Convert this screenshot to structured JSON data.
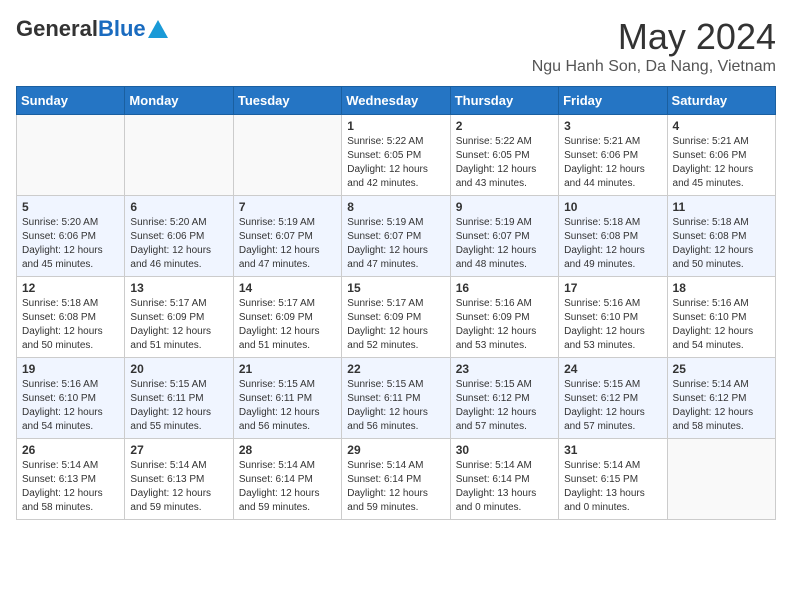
{
  "header": {
    "logo_general": "General",
    "logo_blue": "Blue",
    "title": "May 2024",
    "subtitle": "Ngu Hanh Son, Da Nang, Vietnam"
  },
  "days_of_week": [
    "Sunday",
    "Monday",
    "Tuesday",
    "Wednesday",
    "Thursday",
    "Friday",
    "Saturday"
  ],
  "weeks": [
    [
      {
        "day": "",
        "content": ""
      },
      {
        "day": "",
        "content": ""
      },
      {
        "day": "",
        "content": ""
      },
      {
        "day": "1",
        "content": "Sunrise: 5:22 AM\nSunset: 6:05 PM\nDaylight: 12 hours\nand 42 minutes."
      },
      {
        "day": "2",
        "content": "Sunrise: 5:22 AM\nSunset: 6:05 PM\nDaylight: 12 hours\nand 43 minutes."
      },
      {
        "day": "3",
        "content": "Sunrise: 5:21 AM\nSunset: 6:06 PM\nDaylight: 12 hours\nand 44 minutes."
      },
      {
        "day": "4",
        "content": "Sunrise: 5:21 AM\nSunset: 6:06 PM\nDaylight: 12 hours\nand 45 minutes."
      }
    ],
    [
      {
        "day": "5",
        "content": "Sunrise: 5:20 AM\nSunset: 6:06 PM\nDaylight: 12 hours\nand 45 minutes."
      },
      {
        "day": "6",
        "content": "Sunrise: 5:20 AM\nSunset: 6:06 PM\nDaylight: 12 hours\nand 46 minutes."
      },
      {
        "day": "7",
        "content": "Sunrise: 5:19 AM\nSunset: 6:07 PM\nDaylight: 12 hours\nand 47 minutes."
      },
      {
        "day": "8",
        "content": "Sunrise: 5:19 AM\nSunset: 6:07 PM\nDaylight: 12 hours\nand 47 minutes."
      },
      {
        "day": "9",
        "content": "Sunrise: 5:19 AM\nSunset: 6:07 PM\nDaylight: 12 hours\nand 48 minutes."
      },
      {
        "day": "10",
        "content": "Sunrise: 5:18 AM\nSunset: 6:08 PM\nDaylight: 12 hours\nand 49 minutes."
      },
      {
        "day": "11",
        "content": "Sunrise: 5:18 AM\nSunset: 6:08 PM\nDaylight: 12 hours\nand 50 minutes."
      }
    ],
    [
      {
        "day": "12",
        "content": "Sunrise: 5:18 AM\nSunset: 6:08 PM\nDaylight: 12 hours\nand 50 minutes."
      },
      {
        "day": "13",
        "content": "Sunrise: 5:17 AM\nSunset: 6:09 PM\nDaylight: 12 hours\nand 51 minutes."
      },
      {
        "day": "14",
        "content": "Sunrise: 5:17 AM\nSunset: 6:09 PM\nDaylight: 12 hours\nand 51 minutes."
      },
      {
        "day": "15",
        "content": "Sunrise: 5:17 AM\nSunset: 6:09 PM\nDaylight: 12 hours\nand 52 minutes."
      },
      {
        "day": "16",
        "content": "Sunrise: 5:16 AM\nSunset: 6:09 PM\nDaylight: 12 hours\nand 53 minutes."
      },
      {
        "day": "17",
        "content": "Sunrise: 5:16 AM\nSunset: 6:10 PM\nDaylight: 12 hours\nand 53 minutes."
      },
      {
        "day": "18",
        "content": "Sunrise: 5:16 AM\nSunset: 6:10 PM\nDaylight: 12 hours\nand 54 minutes."
      }
    ],
    [
      {
        "day": "19",
        "content": "Sunrise: 5:16 AM\nSunset: 6:10 PM\nDaylight: 12 hours\nand 54 minutes."
      },
      {
        "day": "20",
        "content": "Sunrise: 5:15 AM\nSunset: 6:11 PM\nDaylight: 12 hours\nand 55 minutes."
      },
      {
        "day": "21",
        "content": "Sunrise: 5:15 AM\nSunset: 6:11 PM\nDaylight: 12 hours\nand 56 minutes."
      },
      {
        "day": "22",
        "content": "Sunrise: 5:15 AM\nSunset: 6:11 PM\nDaylight: 12 hours\nand 56 minutes."
      },
      {
        "day": "23",
        "content": "Sunrise: 5:15 AM\nSunset: 6:12 PM\nDaylight: 12 hours\nand 57 minutes."
      },
      {
        "day": "24",
        "content": "Sunrise: 5:15 AM\nSunset: 6:12 PM\nDaylight: 12 hours\nand 57 minutes."
      },
      {
        "day": "25",
        "content": "Sunrise: 5:14 AM\nSunset: 6:12 PM\nDaylight: 12 hours\nand 58 minutes."
      }
    ],
    [
      {
        "day": "26",
        "content": "Sunrise: 5:14 AM\nSunset: 6:13 PM\nDaylight: 12 hours\nand 58 minutes."
      },
      {
        "day": "27",
        "content": "Sunrise: 5:14 AM\nSunset: 6:13 PM\nDaylight: 12 hours\nand 59 minutes."
      },
      {
        "day": "28",
        "content": "Sunrise: 5:14 AM\nSunset: 6:14 PM\nDaylight: 12 hours\nand 59 minutes."
      },
      {
        "day": "29",
        "content": "Sunrise: 5:14 AM\nSunset: 6:14 PM\nDaylight: 12 hours\nand 59 minutes."
      },
      {
        "day": "30",
        "content": "Sunrise: 5:14 AM\nSunset: 6:14 PM\nDaylight: 13 hours\nand 0 minutes."
      },
      {
        "day": "31",
        "content": "Sunrise: 5:14 AM\nSunset: 6:15 PM\nDaylight: 13 hours\nand 0 minutes."
      },
      {
        "day": "",
        "content": ""
      }
    ]
  ]
}
